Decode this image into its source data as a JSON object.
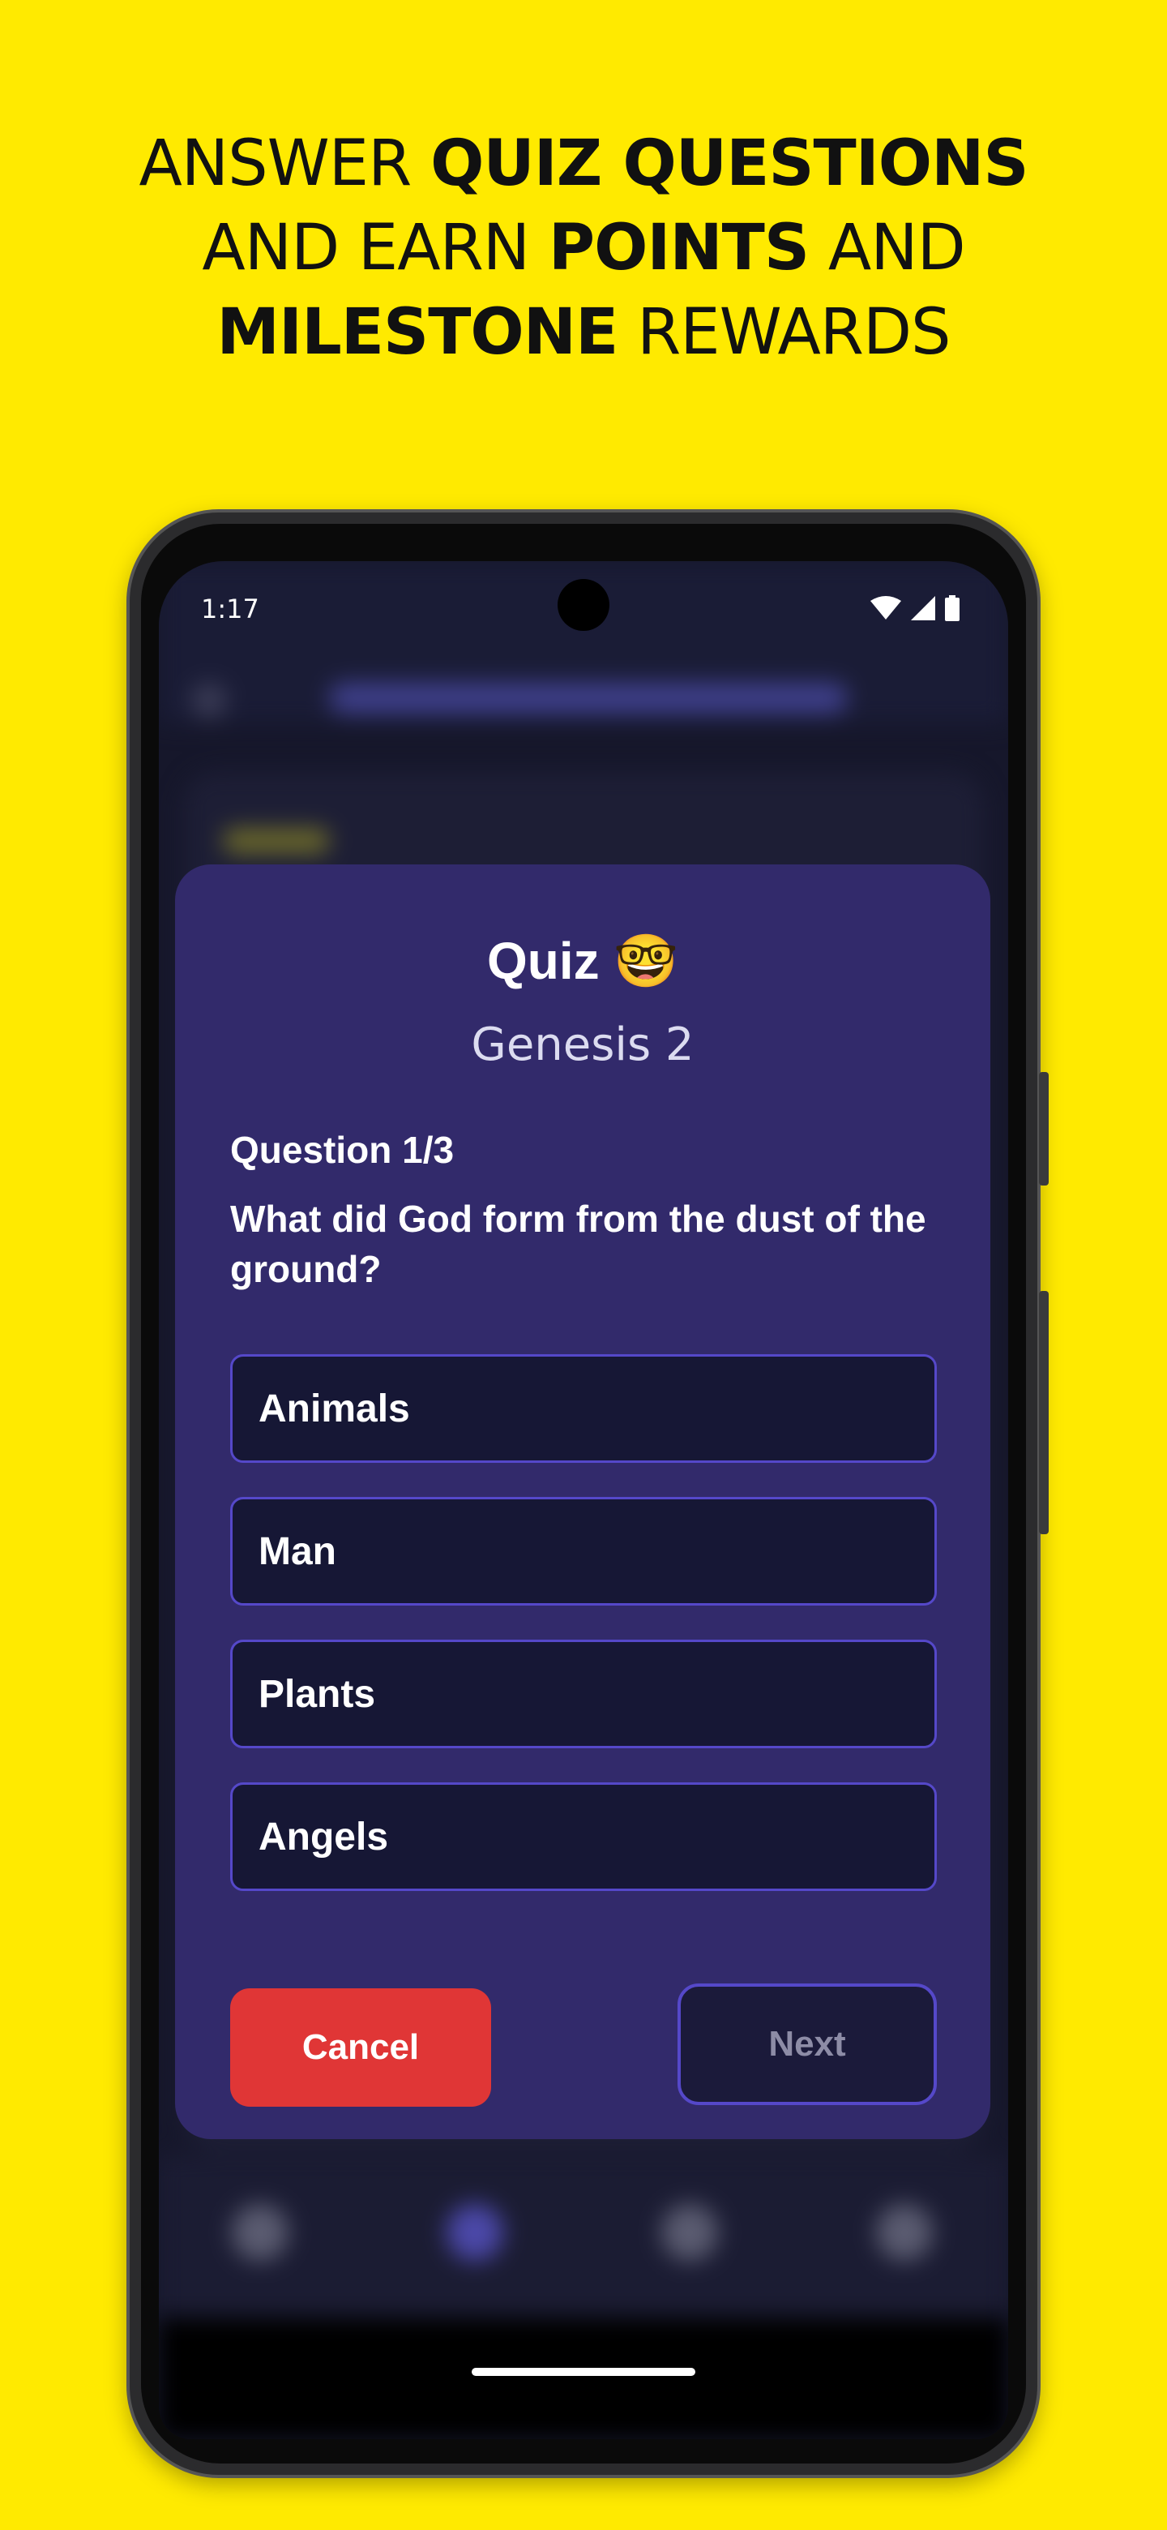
{
  "headline": {
    "line1_regular": "ANSWER ",
    "line1_bold": "QUIZ QUESTIONS",
    "line2_regular_a": "AND EARN ",
    "line2_bold": "POINTS",
    "line2_regular_b": " AND",
    "line3_bold": "MILESTONE",
    "line3_regular": " REWARDS"
  },
  "status_bar": {
    "time": "1:17"
  },
  "quiz": {
    "title": "Quiz 🤓",
    "subtitle": "Genesis 2",
    "question_number": "Question 1/3",
    "question_text": "What did God form from the dust of the ground?",
    "options": [
      "Animals",
      "Man",
      "Plants",
      "Angels"
    ],
    "cancel_label": "Cancel",
    "next_label": "Next"
  },
  "colors": {
    "page_background": "#ffea00",
    "dialog_background": "#322a6b",
    "option_border": "#5548c9",
    "cancel_button": "#e03636"
  }
}
